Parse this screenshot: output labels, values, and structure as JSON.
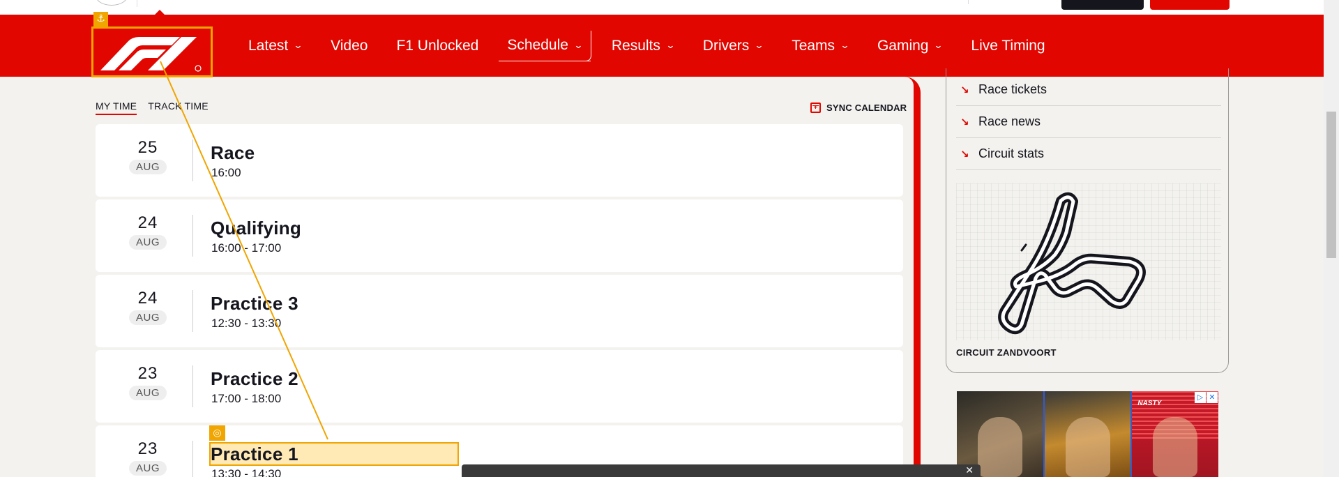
{
  "nav": {
    "items": [
      {
        "label": "Latest",
        "dropdown": true
      },
      {
        "label": "Video",
        "dropdown": false
      },
      {
        "label": "F1 Unlocked",
        "dropdown": false
      },
      {
        "label": "Schedule",
        "dropdown": true,
        "active": true
      },
      {
        "label": "Results",
        "dropdown": true
      },
      {
        "label": "Drivers",
        "dropdown": true
      },
      {
        "label": "Teams",
        "dropdown": true
      },
      {
        "label": "Gaming",
        "dropdown": true
      },
      {
        "label": "Live Timing",
        "dropdown": false
      }
    ],
    "chevron": "⌄"
  },
  "tabs": {
    "my_time": "MY TIME",
    "track_time": "TRACK TIME"
  },
  "sync_label": "SYNC CALENDAR",
  "sessions": [
    {
      "day": "25",
      "month": "AUG",
      "name": "Race",
      "time": "16:00"
    },
    {
      "day": "24",
      "month": "AUG",
      "name": "Qualifying",
      "time": "16:00 - 17:00"
    },
    {
      "day": "24",
      "month": "AUG",
      "name": "Practice 3",
      "time": "12:30 - 13:30"
    },
    {
      "day": "23",
      "month": "AUG",
      "name": "Practice 2",
      "time": "17:00 - 18:00"
    },
    {
      "day": "23",
      "month": "AUG",
      "name": "Practice 1",
      "time": "13:30 - 14:30"
    }
  ],
  "sidebar": {
    "links": [
      {
        "label": "Race tickets",
        "icon": "arrow-down-right-icon"
      },
      {
        "label": "Race news",
        "icon": "arrow-down-right-icon"
      },
      {
        "label": "Circuit stats",
        "icon": "arrow-down-right-icon"
      }
    ],
    "circuit_name": "CIRCUIT ZANDVOORT"
  },
  "ad": {
    "nasty_text": "NASTY"
  },
  "annotations": {
    "anchor_icon": "anchor-icon",
    "target_icon": "target-icon"
  },
  "colors": {
    "brand_red": "#e10600",
    "annotation_orange": "#f0a500",
    "background": "#f3f2ee",
    "text_dark": "#15151e"
  }
}
